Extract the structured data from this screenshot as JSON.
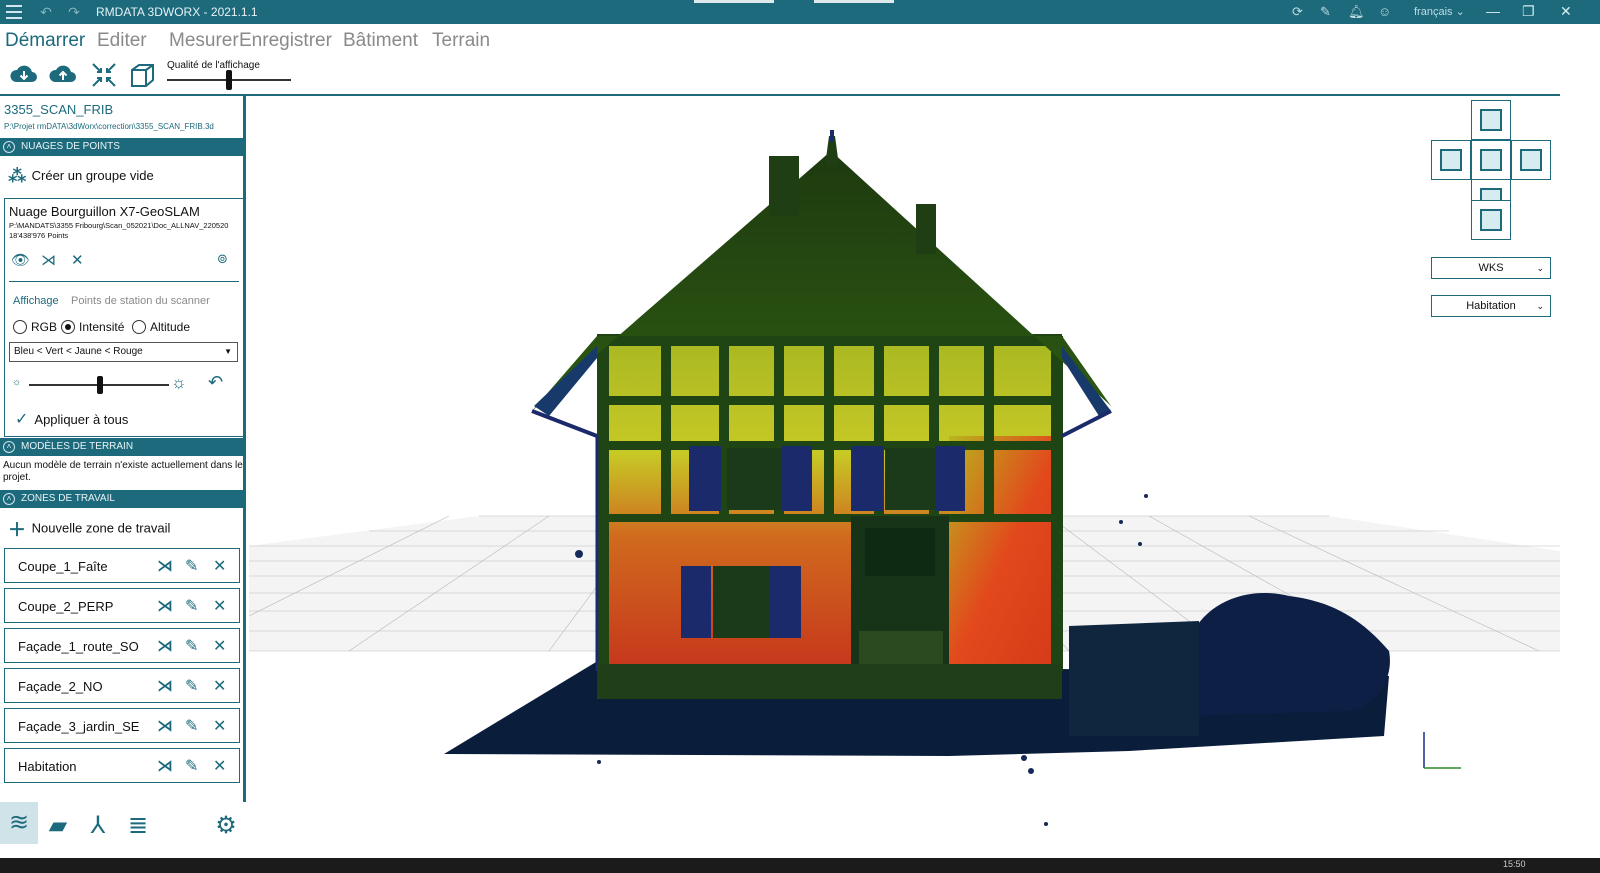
{
  "app": {
    "title": "RMDATA 3DWORX - 2021.1.1",
    "language": "français"
  },
  "menu": [
    "Démarrer",
    "Editer",
    "Mesurer",
    "Enregistrer",
    "Bâtiment",
    "Terrain"
  ],
  "toolbar": {
    "quality_label": "Qualité de l'affichage",
    "quality_level": 0.46
  },
  "project": {
    "name": "3355_SCAN_FRIB",
    "path": "P:\\Projet rmDATA\\3dWorx\\correction\\3355_SCAN_FRIB.3d"
  },
  "sections": {
    "point_clouds": "NUAGES DE POINTS",
    "terrain_models": "MODÈLES DE TERRAIN",
    "work_zones": "ZONES DE TRAVAIL"
  },
  "point_clouds": {
    "create_group": "Créer un groupe vide",
    "cloud": {
      "name": "Nuage Bourguillon X7-GeoSLAM",
      "path": "P:\\MANDATS\\3355 Fribourg\\Scan_052021\\Doc_ALLNAV_220520",
      "points": "18'438'976 Points"
    },
    "tabs": {
      "display": "Affichage",
      "stations": "Points de station du scanner"
    },
    "radio": {
      "rgb": "RGB",
      "intensity": "Intensité",
      "altitude": "Altitude",
      "selected": "Intensité"
    },
    "color_scale": "Bleu < Vert < Jaune < Rouge",
    "brightness_level": 0.5,
    "apply_all": "Appliquer à tous"
  },
  "terrain": {
    "message": "Aucun modèle de terrain n'existe actuellement dans le projet."
  },
  "zones": {
    "new_zone": "Nouvelle zone de travail",
    "items": [
      "Coupe_1_Faîte",
      "Coupe_2_PERP",
      "Façade_1_route_SO",
      "Façade_2_NO",
      "Façade_3_jardin_SE",
      "Habitation"
    ]
  },
  "viewport": {
    "coordinate_system": "WKS",
    "zone_select": "Habitation"
  },
  "taskbar": {
    "time": "15:50"
  },
  "colors": {
    "accent": "#1c6a7c"
  }
}
